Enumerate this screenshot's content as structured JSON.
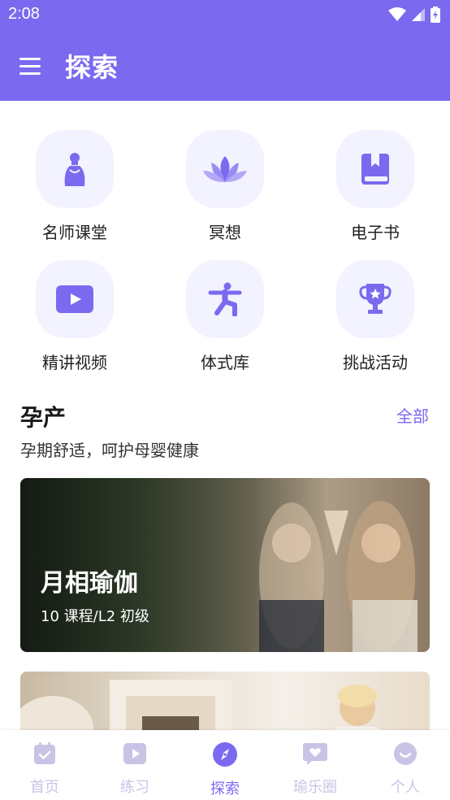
{
  "status_bar": {
    "time": "2:08"
  },
  "app_bar": {
    "title": "探索"
  },
  "features": [
    {
      "label": "名师课堂",
      "icon": "teacher-icon"
    },
    {
      "label": "冥想",
      "icon": "lotus-icon"
    },
    {
      "label": "电子书",
      "icon": "book-icon"
    },
    {
      "label": "精讲视频",
      "icon": "video-play-icon"
    },
    {
      "label": "体式库",
      "icon": "yoga-pose-icon"
    },
    {
      "label": "挑战活动",
      "icon": "trophy-icon"
    }
  ],
  "section": {
    "title": "孕产",
    "link": "全部",
    "subtitle": "孕期舒适，呵护母婴健康"
  },
  "cards": [
    {
      "title": "月相瑜伽",
      "meta": "10 课程/L2 初级"
    },
    {
      "title": "",
      "meta": ""
    }
  ],
  "tabs": [
    {
      "label": "首页",
      "icon": "calendar-icon"
    },
    {
      "label": "练习",
      "icon": "play-icon"
    },
    {
      "label": "探索",
      "icon": "compass-icon",
      "active": true
    },
    {
      "label": "瑜乐圈",
      "icon": "heart-chat-icon"
    },
    {
      "label": "个人",
      "icon": "face-icon"
    }
  ],
  "colors": {
    "accent": "#7b69f0",
    "tile_bg": "#f3f2ff",
    "tab_inactive": "#c8c4e6"
  }
}
